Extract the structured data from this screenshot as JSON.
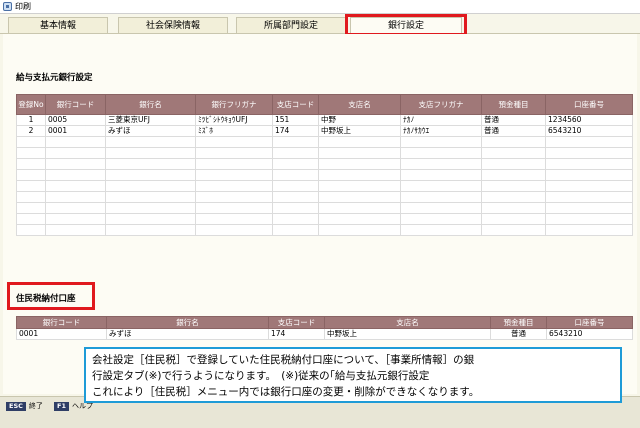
{
  "window": {
    "title": "印刷"
  },
  "tabs": [
    {
      "label": "基本情報"
    },
    {
      "label": "社会保険情報"
    },
    {
      "label": "所属部門設定"
    },
    {
      "label": "銀行設定"
    }
  ],
  "bank_section": {
    "title": "給与支払元銀行設定",
    "headers": [
      "登録No",
      "銀行コード",
      "銀行名",
      "銀行フリガナ",
      "支店コード",
      "支店名",
      "支店フリガナ",
      "預金種目",
      "口座番号"
    ],
    "rows": [
      [
        "1",
        "0005",
        "三菱東京UFJ",
        "ﾐﾂﾋﾞｼﾄｳｷｮｳUFJ",
        "151",
        "中野",
        "ﾅｶﾉ",
        "普通",
        "1234560"
      ],
      [
        "2",
        "0001",
        "みずほ",
        "ﾐｽﾞﾎ",
        "174",
        "中野坂上",
        "ﾅｶﾉｻｶｳｴ",
        "普通",
        "6543210"
      ]
    ]
  },
  "resident_section": {
    "title": "住民税納付口座",
    "headers": [
      "銀行コード",
      "銀行名",
      "支店コード",
      "支店名",
      "預金種目",
      "口座番号"
    ],
    "row": [
      "0001",
      "みずほ",
      "174",
      "中野坂上",
      "普通",
      "6543210"
    ]
  },
  "note": {
    "lines": [
      "会社設定［住民税］で登録していた住民税納付口座について、［事業所情報］の銀",
      "行設定タブ(※)で行うようになります。　(※)従来の｢給与支払元銀行設定",
      "これにより［住民税］メニュー内では銀行口座の変更・削除ができなくなります。"
    ]
  },
  "function_keys": [
    {
      "key": "ESC",
      "label": "終了"
    },
    {
      "key": "F1",
      "label": "ヘルプ"
    }
  ]
}
